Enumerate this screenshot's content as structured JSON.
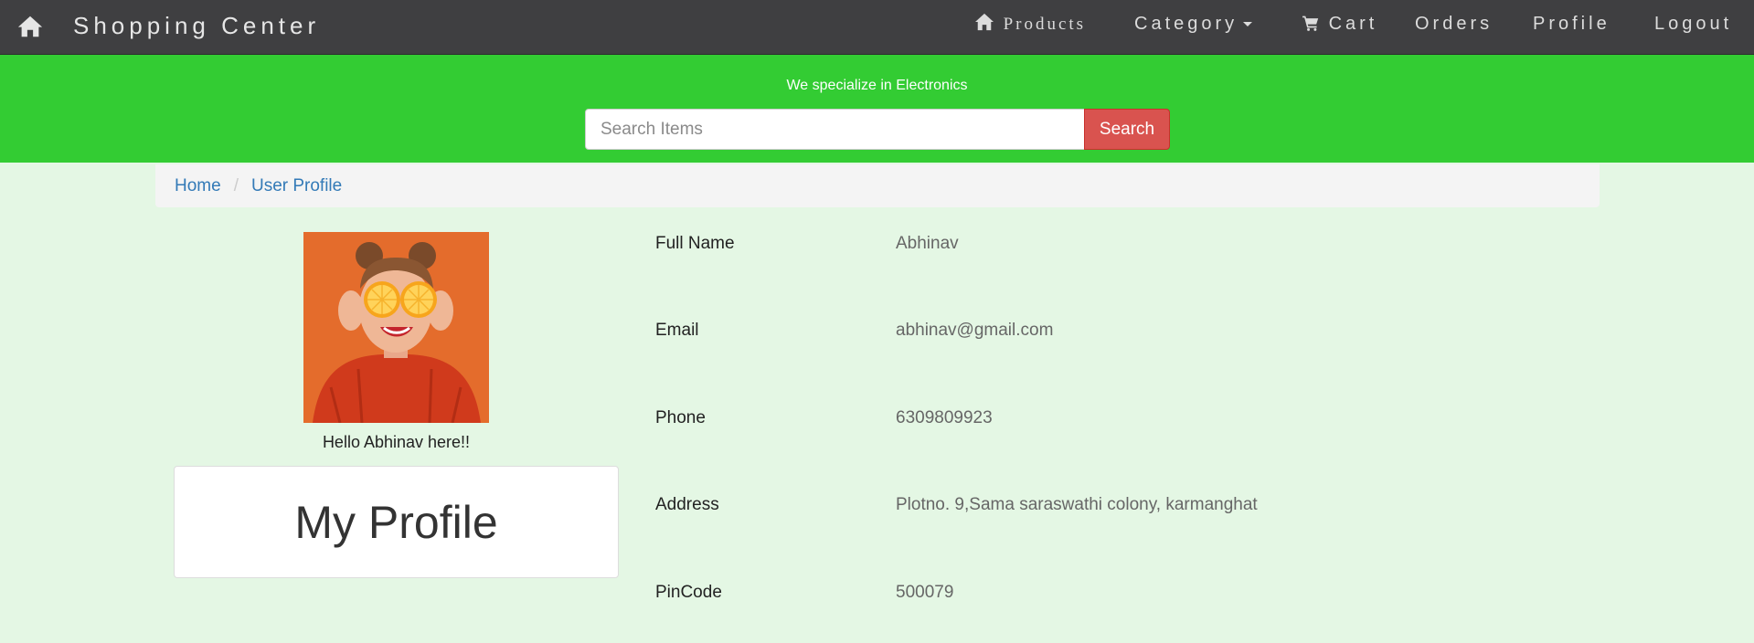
{
  "navbar": {
    "home_icon": "home-icon",
    "brand": "Shopping Center",
    "products_icon": "home-icon",
    "products_label": "Products",
    "category_label": "Category",
    "cart_icon": "cart-icon",
    "cart_label": "Cart",
    "orders_label": "Orders",
    "profile_label": "Profile",
    "logout_label": "Logout"
  },
  "banner": {
    "tagline": "We specialize in Electronics",
    "search_placeholder": "Search Items",
    "search_button": "Search"
  },
  "breadcrumb": {
    "items": [
      "Home",
      "User Profile"
    ],
    "separator": "/"
  },
  "profile": {
    "greeting": "Hello Abhinav here!!",
    "card_title": "My Profile"
  },
  "details": [
    {
      "label": "Full Name",
      "value": "Abhinav"
    },
    {
      "label": "Email",
      "value": "abhinav@gmail.com"
    },
    {
      "label": "Phone",
      "value": "6309809923"
    },
    {
      "label": "Address",
      "value": "Plotno. 9,Sama saraswathi colony, karmanghat"
    },
    {
      "label": "PinCode",
      "value": "500079"
    }
  ],
  "colors": {
    "navbar": "#3f3f41",
    "banner": "#33cc33",
    "page_background": "#e4f7e4",
    "search_button": "#d9534f",
    "link": "#337ab7"
  }
}
